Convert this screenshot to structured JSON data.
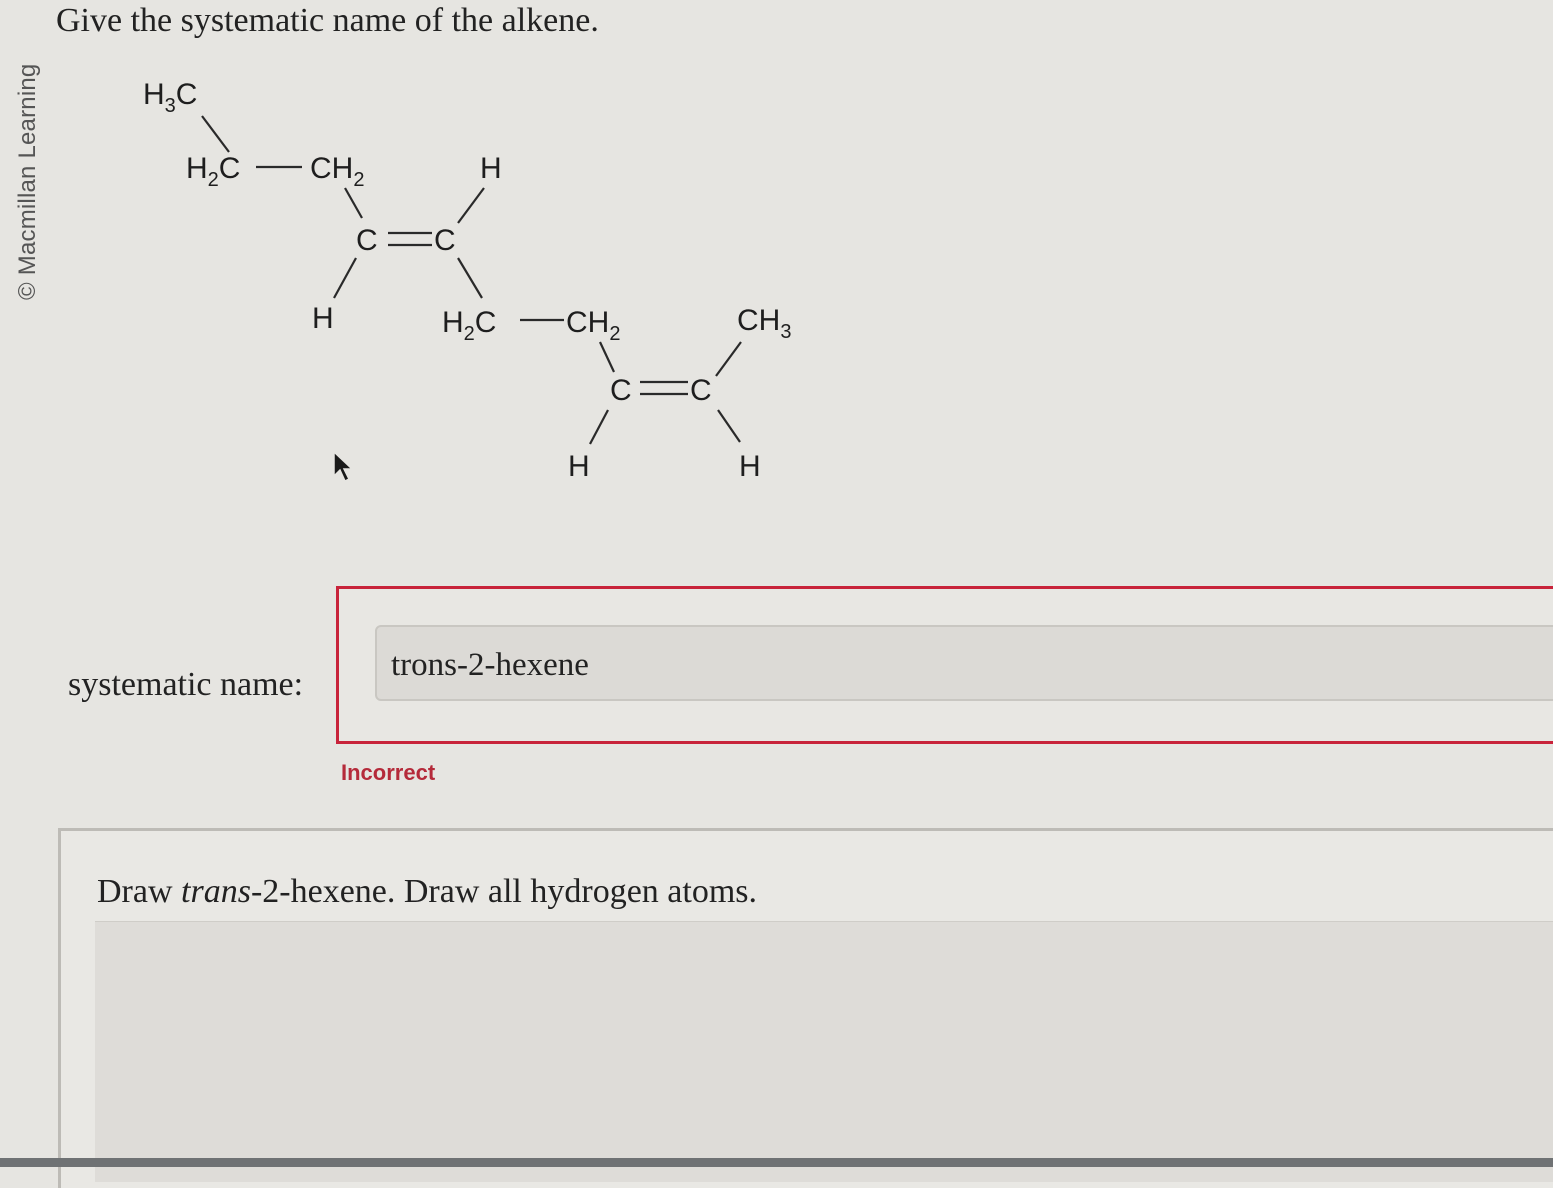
{
  "copyright": "© Macmillan Learning",
  "question": "Give the systematic name of the alkene.",
  "structure": {
    "labels": {
      "h3c_top": "H3C",
      "h2c_left": "H2C",
      "ch2_left": "CH2",
      "h_top": "H",
      "c1": "C",
      "c2": "C",
      "h_bottom_left": "H",
      "h2c_mid": "H2C",
      "ch2_mid": "CH2",
      "ch3_right": "CH3",
      "c3": "C",
      "c4": "C",
      "h_bottom_mid": "H",
      "h_bottom_right": "H"
    }
  },
  "answer": {
    "label": "systematic name:",
    "value": "trons-2-hexene",
    "status": "Incorrect",
    "status_color": "#b52a3a",
    "border_color": "#c8233a"
  },
  "part2": {
    "prompt_before": "Draw ",
    "prompt_italic": "trans",
    "prompt_after": "-2-hexene. Draw all hydrogen atoms."
  }
}
